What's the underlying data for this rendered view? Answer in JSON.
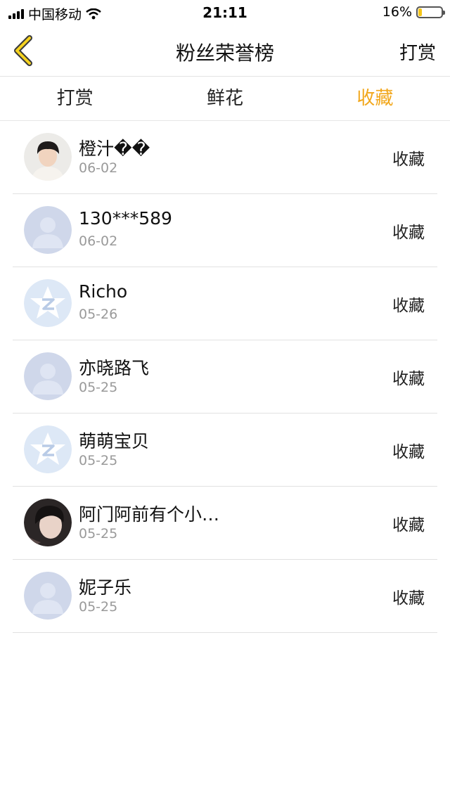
{
  "status_bar": {
    "carrier": "中国移动",
    "time": "21:11",
    "battery": "16%",
    "battery_level": 0.16
  },
  "nav": {
    "title": "粉丝荣誉榜",
    "right_label": "打赏",
    "back_icon": "chevron-left-icon"
  },
  "tabs": [
    {
      "label": "打赏",
      "active": false
    },
    {
      "label": "鲜花",
      "active": false
    },
    {
      "label": "收藏",
      "active": true
    }
  ],
  "accent_color": "#f2a71b",
  "fans": [
    {
      "name": "橙汁��",
      "date": "06-02",
      "action": "收藏",
      "avatar": "photo-boy"
    },
    {
      "name": "130***589",
      "date": "06-02",
      "action": "收藏",
      "avatar": "default-person"
    },
    {
      "name": "Richo",
      "date": "05-26",
      "action": "收藏",
      "avatar": "qq-star"
    },
    {
      "name": "亦晓路飞",
      "date": "05-25",
      "action": "收藏",
      "avatar": "default-person"
    },
    {
      "name": "萌萌宝贝",
      "date": "05-25",
      "action": "收藏",
      "avatar": "qq-star"
    },
    {
      "name": "阿门阿前有个小…",
      "date": "05-25",
      "action": "收藏",
      "avatar": "photo-dark"
    },
    {
      "name": "妮子乐",
      "date": "05-25",
      "action": "收藏",
      "avatar": "default-person"
    }
  ]
}
